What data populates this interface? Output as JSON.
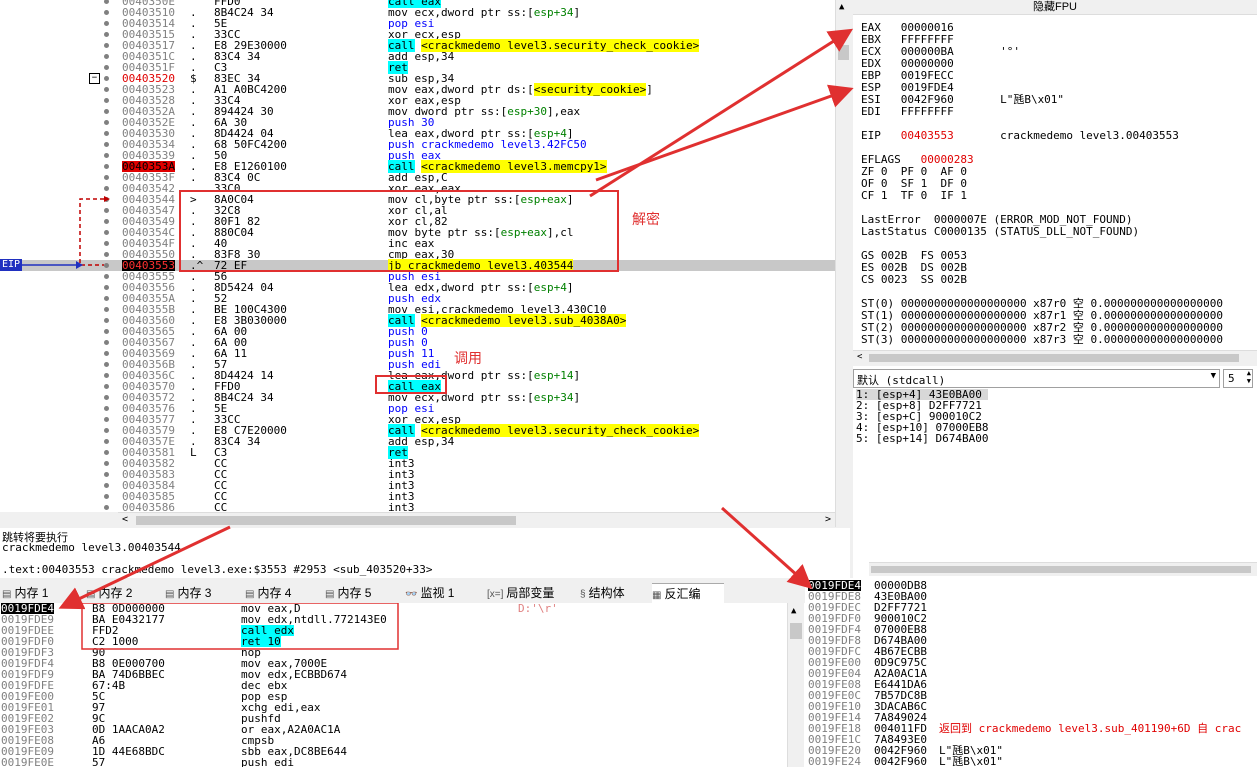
{
  "cpu": {
    "rows": [
      {
        "addr": "0040350E",
        "marker": "",
        "bytes": "FFD0",
        "asm": [
          {
            "t": "call eax",
            "c": "hl-cyan"
          }
        ]
      },
      {
        "addr": "00403510",
        "marker": ".",
        "bytes": "8B4C24 34",
        "asm": [
          {
            "t": "mov ecx,dword ptr ss:[",
            "c": ""
          },
          {
            "t": "esp+34",
            "c": "kw-green"
          },
          {
            "t": "]",
            "c": ""
          }
        ]
      },
      {
        "addr": "00403514",
        "marker": ".",
        "bytes": "5E",
        "asm": [
          {
            "t": "pop esi",
            "c": "kw-blue"
          }
        ]
      },
      {
        "addr": "00403515",
        "marker": ".",
        "bytes": "33CC",
        "asm": [
          {
            "t": "xor ecx,esp",
            "c": ""
          }
        ]
      },
      {
        "addr": "00403517",
        "marker": ".",
        "bytes": "E8 29E30000",
        "asm": [
          {
            "t": "call",
            "c": "hl-cyan"
          },
          {
            "t": " ",
            "c": ""
          },
          {
            "t": "<crackmedemo level3.security_check_cookie>",
            "c": "hl-yellow"
          }
        ]
      },
      {
        "addr": "0040351C",
        "marker": ".",
        "bytes": "83C4 34",
        "asm": [
          {
            "t": "add esp,34",
            "c": ""
          }
        ]
      },
      {
        "addr": "0040351F",
        "marker": ".",
        "bytes": "C3",
        "asm": [
          {
            "t": "ret",
            "c": "hl-cyan"
          }
        ]
      },
      {
        "addr": "00403520",
        "marker": "$",
        "bytes": "83EC 34",
        "asm": [
          {
            "t": "sub esp,34",
            "c": ""
          }
        ],
        "addrRed": true
      },
      {
        "addr": "00403523",
        "marker": ".",
        "bytes": "A1 A0BC4200",
        "asm": [
          {
            "t": "mov eax,dword ptr ds:[",
            "c": ""
          },
          {
            "t": "<security_cookie>",
            "c": "hl-yellow"
          },
          {
            "t": "]",
            "c": ""
          }
        ]
      },
      {
        "addr": "00403528",
        "marker": ".",
        "bytes": "33C4",
        "asm": [
          {
            "t": "xor eax,esp",
            "c": ""
          }
        ]
      },
      {
        "addr": "0040352A",
        "marker": ".",
        "bytes": "894424 30",
        "asm": [
          {
            "t": "mov dword ptr ss:[",
            "c": ""
          },
          {
            "t": "esp+30",
            "c": "kw-green"
          },
          {
            "t": "],eax",
            "c": ""
          }
        ]
      },
      {
        "addr": "0040352E",
        "marker": ".",
        "bytes": "6A 30",
        "asm": [
          {
            "t": "push 30",
            "c": "kw-blue"
          }
        ]
      },
      {
        "addr": "00403530",
        "marker": ".",
        "bytes": "8D4424 04",
        "asm": [
          {
            "t": "lea eax,dword ptr ss:[",
            "c": ""
          },
          {
            "t": "esp+4",
            "c": "kw-green"
          },
          {
            "t": "]",
            "c": ""
          }
        ]
      },
      {
        "addr": "00403534",
        "marker": ".",
        "bytes": "68 50FC4200",
        "asm": [
          {
            "t": "push crackmedemo level3.42FC50",
            "c": "kw-blue"
          }
        ]
      },
      {
        "addr": "00403539",
        "marker": ".",
        "bytes": "50",
        "asm": [
          {
            "t": "push eax",
            "c": "kw-blue"
          }
        ]
      },
      {
        "addr": "0040353A",
        "marker": ".",
        "bytes": "E8 E1260100",
        "asm": [
          {
            "t": "call",
            "c": "hl-cyan"
          },
          {
            "t": " ",
            "c": ""
          },
          {
            "t": "<crackmedemo level3.memcpy1>",
            "c": "hl-yellow"
          }
        ],
        "addrBg": "#e00000"
      },
      {
        "addr": "0040353F",
        "marker": ".",
        "bytes": "83C4 0C",
        "asm": [
          {
            "t": "add esp,C",
            "c": ""
          }
        ]
      },
      {
        "addr": "00403542",
        "marker": ".",
        "bytes": "33C0",
        "asm": [
          {
            "t": "xor eax,eax",
            "c": ""
          }
        ]
      },
      {
        "addr": "00403544",
        "marker": ">",
        "bytes": "8A0C04",
        "asm": [
          {
            "t": "mov cl,byte ptr ss:[",
            "c": ""
          },
          {
            "t": "esp+eax",
            "c": "kw-green"
          },
          {
            "t": "]",
            "c": ""
          }
        ]
      },
      {
        "addr": "00403547",
        "marker": ".",
        "bytes": "32C8",
        "asm": [
          {
            "t": "xor cl,al",
            "c": ""
          }
        ]
      },
      {
        "addr": "00403549",
        "marker": ".",
        "bytes": "80F1 82",
        "asm": [
          {
            "t": "xor cl,82",
            "c": ""
          }
        ]
      },
      {
        "addr": "0040354C",
        "marker": ".",
        "bytes": "880C04",
        "asm": [
          {
            "t": "mov byte ptr ss:[",
            "c": ""
          },
          {
            "t": "esp+eax",
            "c": "kw-green"
          },
          {
            "t": "],cl",
            "c": ""
          }
        ]
      },
      {
        "addr": "0040354F",
        "marker": ".",
        "bytes": "40",
        "asm": [
          {
            "t": "inc eax",
            "c": ""
          }
        ]
      },
      {
        "addr": "00403550",
        "marker": ".",
        "bytes": "83F8 30",
        "asm": [
          {
            "t": "cmp eax,30",
            "c": ""
          }
        ]
      },
      {
        "addr": "00403553",
        "marker": ".^",
        "bytes": "72 EF",
        "asm": [
          {
            "t": "jb crackmedemo level3.403544",
            "c": "hl-yellow"
          }
        ],
        "current": true
      },
      {
        "addr": "00403555",
        "marker": ".",
        "bytes": "56",
        "asm": [
          {
            "t": "push esi",
            "c": "kw-blue"
          }
        ]
      },
      {
        "addr": "00403556",
        "marker": ".",
        "bytes": "8D5424 04",
        "asm": [
          {
            "t": "lea edx,dword ptr ss:[",
            "c": ""
          },
          {
            "t": "esp+4",
            "c": "kw-green"
          },
          {
            "t": "]",
            "c": ""
          }
        ]
      },
      {
        "addr": "0040355A",
        "marker": ".",
        "bytes": "52",
        "asm": [
          {
            "t": "push edx",
            "c": "kw-blue"
          }
        ]
      },
      {
        "addr": "0040355B",
        "marker": ".",
        "bytes": "BE 100C4300",
        "asm": [
          {
            "t": "mov esi,crackmedemo level3.430C10",
            "c": ""
          }
        ]
      },
      {
        "addr": "00403560",
        "marker": ".",
        "bytes": "E8 3B030000",
        "asm": [
          {
            "t": "call",
            "c": "hl-cyan"
          },
          {
            "t": " ",
            "c": ""
          },
          {
            "t": "<crackmedemo level3.sub_4038A0>",
            "c": "hl-yellow"
          }
        ]
      },
      {
        "addr": "00403565",
        "marker": ".",
        "bytes": "6A 00",
        "asm": [
          {
            "t": "push 0",
            "c": "kw-blue"
          }
        ]
      },
      {
        "addr": "00403567",
        "marker": ".",
        "bytes": "6A 00",
        "asm": [
          {
            "t": "push 0",
            "c": "kw-blue"
          }
        ]
      },
      {
        "addr": "00403569",
        "marker": ".",
        "bytes": "6A 11",
        "asm": [
          {
            "t": "push 11",
            "c": "kw-blue"
          }
        ]
      },
      {
        "addr": "0040356B",
        "marker": ".",
        "bytes": "57",
        "asm": [
          {
            "t": "push edi",
            "c": "kw-blue"
          }
        ]
      },
      {
        "addr": "0040356C",
        "marker": ".",
        "bytes": "8D4424 14",
        "asm": [
          {
            "t": "lea eax,dword ptr ss:[",
            "c": ""
          },
          {
            "t": "esp+14",
            "c": "kw-green"
          },
          {
            "t": "]",
            "c": ""
          }
        ]
      },
      {
        "addr": "00403570",
        "marker": ".",
        "bytes": "FFD0",
        "asm": [
          {
            "t": "call eax",
            "c": "hl-cyan"
          }
        ]
      },
      {
        "addr": "00403572",
        "marker": ".",
        "bytes": "8B4C24 34",
        "asm": [
          {
            "t": "mov ecx,dword ptr ss:[",
            "c": ""
          },
          {
            "t": "esp+34",
            "c": "kw-green"
          },
          {
            "t": "]",
            "c": ""
          }
        ]
      },
      {
        "addr": "00403576",
        "marker": ".",
        "bytes": "5E",
        "asm": [
          {
            "t": "pop esi",
            "c": "kw-blue"
          }
        ]
      },
      {
        "addr": "00403577",
        "marker": ".",
        "bytes": "33CC",
        "asm": [
          {
            "t": "xor ecx,esp",
            "c": ""
          }
        ]
      },
      {
        "addr": "00403579",
        "marker": ".",
        "bytes": "E8 C7E20000",
        "asm": [
          {
            "t": "call",
            "c": "hl-cyan"
          },
          {
            "t": " ",
            "c": ""
          },
          {
            "t": "<crackmedemo level3.security_check_cookie>",
            "c": "hl-yellow"
          }
        ]
      },
      {
        "addr": "0040357E",
        "marker": ".",
        "bytes": "83C4 34",
        "asm": [
          {
            "t": "add esp,34",
            "c": ""
          }
        ]
      },
      {
        "addr": "00403581",
        "marker": "L",
        "bytes": "C3",
        "asm": [
          {
            "t": "ret",
            "c": "hl-cyan"
          }
        ]
      },
      {
        "addr": "00403582",
        "marker": "",
        "bytes": "CC",
        "asm": [
          {
            "t": "int3",
            "c": ""
          }
        ]
      },
      {
        "addr": "00403583",
        "marker": "",
        "bytes": "CC",
        "asm": [
          {
            "t": "int3",
            "c": ""
          }
        ]
      },
      {
        "addr": "00403584",
        "marker": "",
        "bytes": "CC",
        "asm": [
          {
            "t": "int3",
            "c": ""
          }
        ]
      },
      {
        "addr": "00403585",
        "marker": "",
        "bytes": "CC",
        "asm": [
          {
            "t": "int3",
            "c": ""
          }
        ]
      },
      {
        "addr": "00403586",
        "marker": "",
        "bytes": "CC",
        "asm": [
          {
            "t": "int3",
            "c": ""
          }
        ]
      }
    ],
    "eip_label": "EIP"
  },
  "annotations": {
    "decrypt": "解密",
    "call": "调用"
  },
  "regs": {
    "title": "隐藏FPU",
    "lines": [
      "EAX   00000016",
      "EBX   FFFFFFFF",
      "ECX   000000BA       '°'",
      "EDX   00000000",
      "EBP   0019FECC",
      "ESP   0019FDE4",
      "ESI   0042F960       L\"瓱B\\x01\"",
      "EDI   FFFFFFFF",
      "",
      "EIP   00403553       crackmedemo level3.00403553",
      "",
      "EFLAGS   00000283",
      "ZF 0  PF 0  AF 0",
      "OF 0  SF 1  DF 0",
      "CF 1  TF 0  IF 1",
      "",
      "LastError  0000007E (ERROR_MOD_NOT_FOUND)",
      "LastStatus C0000135 (STATUS_DLL_NOT_FOUND)",
      "",
      "GS 002B  FS 0053",
      "ES 002B  DS 002B",
      "CS 0023  SS 002B",
      "",
      "ST(0) 0000000000000000000 x87r0 空 0.000000000000000000",
      "ST(1) 0000000000000000000 x87r1 空 0.000000000000000000",
      "ST(2) 0000000000000000000 x87r2 空 0.000000000000000000",
      "ST(3) 0000000000000000000 x87r3 空 0.000000000000000000"
    ]
  },
  "callconv": {
    "select": "默认 (stdcall)",
    "count": "5",
    "args": [
      "1: [esp+4] 43E0BA00",
      "2: [esp+8] D2FF7721",
      "3: [esp+C] 900010C2",
      "4: [esp+10] 07000EB8",
      "5: [esp+14] D674BA00"
    ]
  },
  "info": {
    "line1": "跳转将要执行",
    "line2": "crackmedemo level3.00403544",
    "line3": ".text:00403553 crackmedemo level3.exe:$3553 #2953 <sub_403520+33>"
  },
  "tabs": [
    {
      "label": "内存 1",
      "icon": "memory-icon"
    },
    {
      "label": "内存 2",
      "icon": "memory-icon"
    },
    {
      "label": "内存 3",
      "icon": "memory-icon"
    },
    {
      "label": "内存 4",
      "icon": "memory-icon"
    },
    {
      "label": "内存 5",
      "icon": "memory-icon"
    },
    {
      "label": "监视 1",
      "icon": "watch-icon"
    },
    {
      "label": "局部变量",
      "icon": "locals-icon",
      "prefix": "[x=]"
    },
    {
      "label": "结构体",
      "icon": "struct-icon"
    },
    {
      "label": "反汇编",
      "icon": "disasm-icon",
      "active": true
    }
  ],
  "dump": {
    "rows": [
      {
        "addr": "0019FDE4",
        "bytes": "B8 0D000000",
        "asm": "mov eax,D",
        "note": "D:'\\r'",
        "first": true
      },
      {
        "addr": "0019FDE9",
        "bytes": "BA E0432177",
        "asm": "mov edx,ntdll.772143E0"
      },
      {
        "addr": "0019FDEE",
        "bytes": "FFD2",
        "asm": "call edx",
        "cyan": true
      },
      {
        "addr": "0019FDF0",
        "bytes": "C2 1000",
        "asm": "ret 10",
        "cyan": true
      },
      {
        "addr": "0019FDF3",
        "bytes": "90",
        "asm": "nop"
      },
      {
        "addr": "0019FDF4",
        "bytes": "B8 0E000700",
        "asm": "mov eax,7000E"
      },
      {
        "addr": "0019FDF9",
        "bytes": "BA 74D6BBEC",
        "asm": "mov edx,ECBBD674"
      },
      {
        "addr": "0019FDFE",
        "bytes": "67:4B",
        "asm": "dec ebx"
      },
      {
        "addr": "0019FE00",
        "bytes": "5C",
        "asm": "pop esp"
      },
      {
        "addr": "0019FE01",
        "bytes": "97",
        "asm": "xchg edi,eax"
      },
      {
        "addr": "0019FE02",
        "bytes": "9C",
        "asm": "pushfd"
      },
      {
        "addr": "0019FE03",
        "bytes": "0D 1AACA0A2",
        "asm": "or eax,A2A0AC1A"
      },
      {
        "addr": "0019FE08",
        "bytes": "A6",
        "asm": "cmpsb"
      },
      {
        "addr": "0019FE09",
        "bytes": "1D 44E68BDC",
        "asm": "sbb eax,DC8BE644"
      },
      {
        "addr": "0019FE0E",
        "bytes": "57",
        "asm": "push edi"
      }
    ]
  },
  "stack": {
    "rows": [
      {
        "addr": "0019FDE4",
        "val": "00000DB8",
        "cmt": "",
        "top": true
      },
      {
        "addr": "0019FDE8",
        "val": "43E0BA00",
        "cmt": ""
      },
      {
        "addr": "0019FDEC",
        "val": "D2FF7721",
        "cmt": ""
      },
      {
        "addr": "0019FDF0",
        "val": "900010C2",
        "cmt": ""
      },
      {
        "addr": "0019FDF4",
        "val": "07000EB8",
        "cmt": ""
      },
      {
        "addr": "0019FDF8",
        "val": "D674BA00",
        "cmt": ""
      },
      {
        "addr": "0019FDFC",
        "val": "4B67ECBB",
        "cmt": ""
      },
      {
        "addr": "0019FE00",
        "val": "0D9C975C",
        "cmt": ""
      },
      {
        "addr": "0019FE04",
        "val": "A2A0AC1A",
        "cmt": ""
      },
      {
        "addr": "0019FE08",
        "val": "E6441DA6",
        "cmt": ""
      },
      {
        "addr": "0019FE0C",
        "val": "7B57DC8B",
        "cmt": ""
      },
      {
        "addr": "0019FE10",
        "val": "3DACAB6C",
        "cmt": ""
      },
      {
        "addr": "0019FE14",
        "val": "7A849024",
        "cmt": ""
      },
      {
        "addr": "0019FE18",
        "val": "004011FD",
        "cmt": "返回到 crackmedemo level3.sub_401190+6D 自 crac",
        "red": true
      },
      {
        "addr": "0019FE1C",
        "val": "7A8493E0",
        "cmt": ""
      },
      {
        "addr": "0019FE20",
        "val": "0042F960",
        "cmt": "L\"瓱B\\x01\""
      },
      {
        "addr": "0019FE24",
        "val": "0042F960",
        "cmt": "L\"瓱B\\x01\""
      }
    ]
  }
}
